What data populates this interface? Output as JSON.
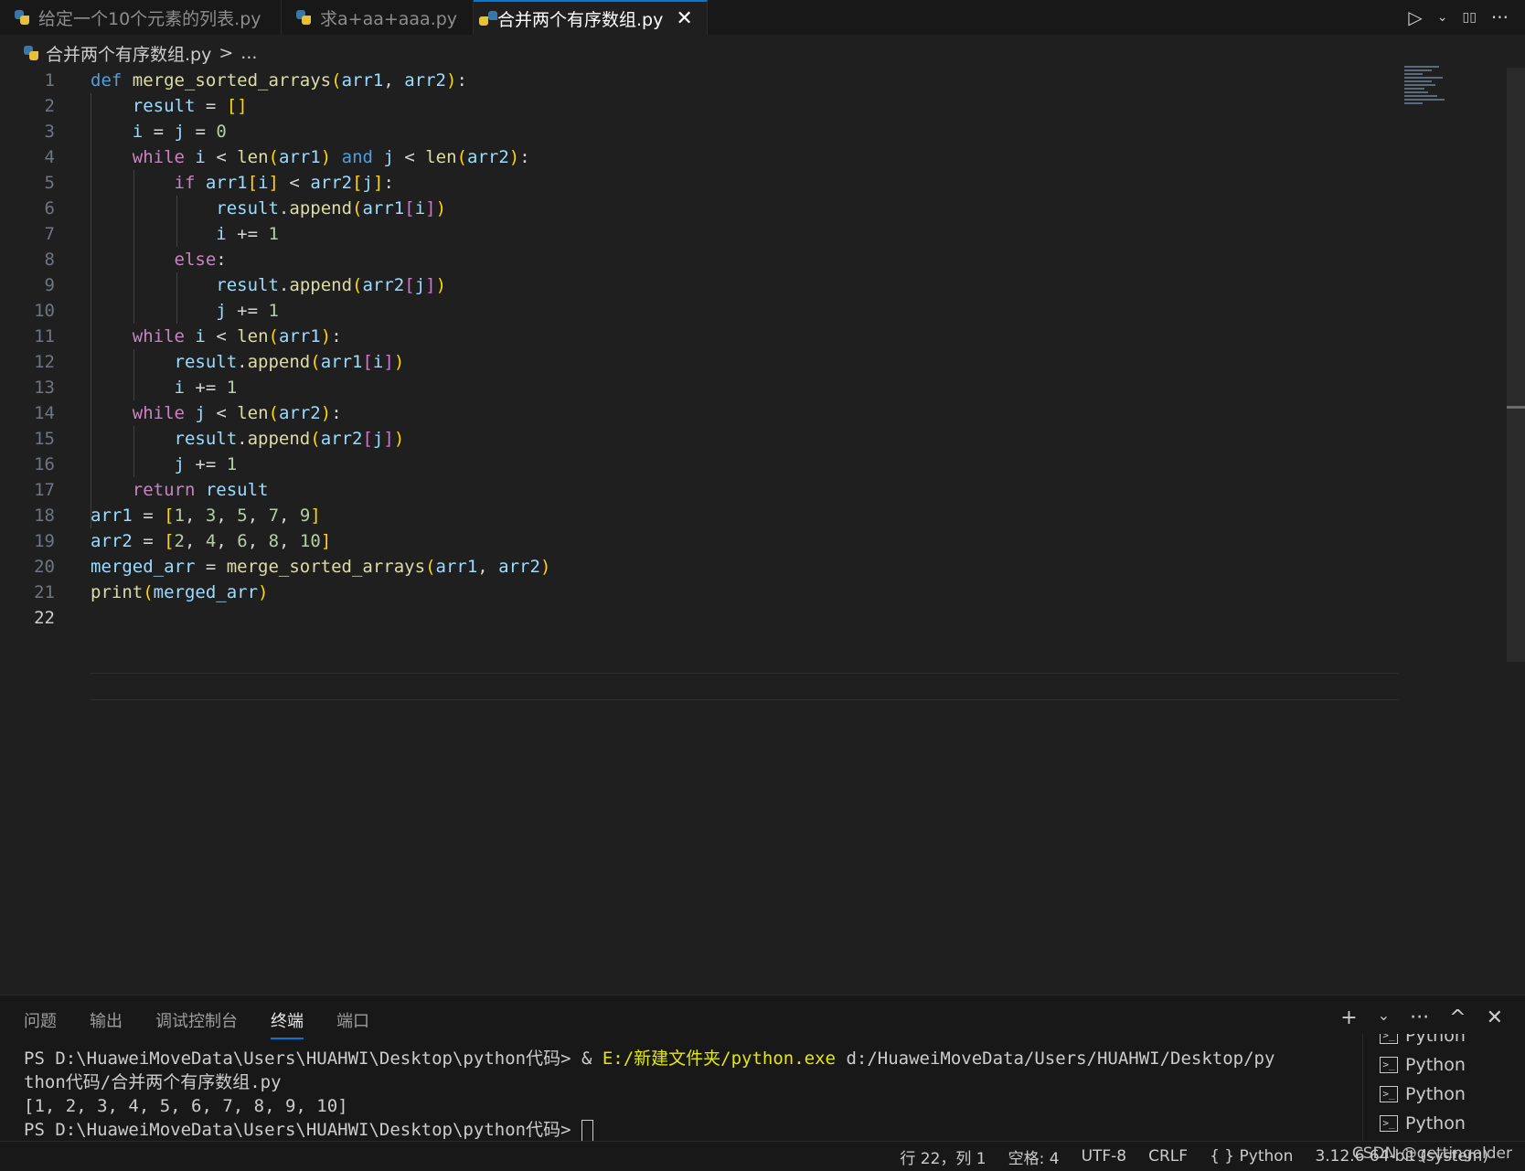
{
  "tabs": [
    {
      "label": "给定一个10个元素的列表.py",
      "active": false
    },
    {
      "label": "求a+aa+aaa.py",
      "active": false
    },
    {
      "label": "合并两个有序数组.py",
      "active": true
    }
  ],
  "tab_actions": {
    "run": "▷",
    "run_menu": "⌄",
    "split": "▯▯",
    "more": "···",
    "close": "✕"
  },
  "breadcrumb": {
    "file": "合并两个有序数组.py",
    "separator": ">",
    "more": "..."
  },
  "editor": {
    "line_numbers": [
      "1",
      "2",
      "3",
      "4",
      "5",
      "6",
      "7",
      "8",
      "9",
      "10",
      "11",
      "12",
      "13",
      "14",
      "15",
      "16",
      "17",
      "18",
      "19",
      "20",
      "21",
      "22"
    ],
    "current_line": "22"
  },
  "panel": {
    "tabs": [
      "问题",
      "输出",
      "调试控制台",
      "终端",
      "端口"
    ],
    "active_tab": "终端",
    "actions": {
      "add": "+",
      "dropdown": "⌄",
      "more": "···",
      "maximize": "^",
      "close": "✕"
    },
    "terminal": {
      "prompt1": "PS D:\\HuaweiMoveData\\Users\\HUAHWI\\Desktop\\python代码> ",
      "cmd_amp": "& ",
      "cmd_exe": "E:/新建文件夹/python.exe",
      "cmd_arg": " d:/HuaweiMoveData/Users/HUAHWI/Desktop/py",
      "cmd_arg_wrap": "thon代码/合并两个有序数组.py",
      "output": "[1, 2, 3, 4, 5, 6, 7, 8, 9, 10]",
      "prompt2": "PS D:\\HuaweiMoveData\\Users\\HUAHWI\\Desktop\\python代码> "
    },
    "terminal_list": [
      "Python",
      "Python",
      "Python",
      "Python"
    ]
  },
  "statusbar": {
    "position": "行 22，列 1",
    "spaces": "空格: 4",
    "encoding": "UTF-8",
    "eol": "CRLF",
    "language": "{ } Python",
    "interpreter": "3.12.6 64-bit (system)",
    "watermark": "CSDN @gettingolder"
  },
  "colors": {
    "accent": "#0078d4",
    "keyword": "#569cd6",
    "control": "#c586c0",
    "function": "#dcdcaa",
    "variable": "#9cdcfe",
    "number": "#b5cea8"
  }
}
